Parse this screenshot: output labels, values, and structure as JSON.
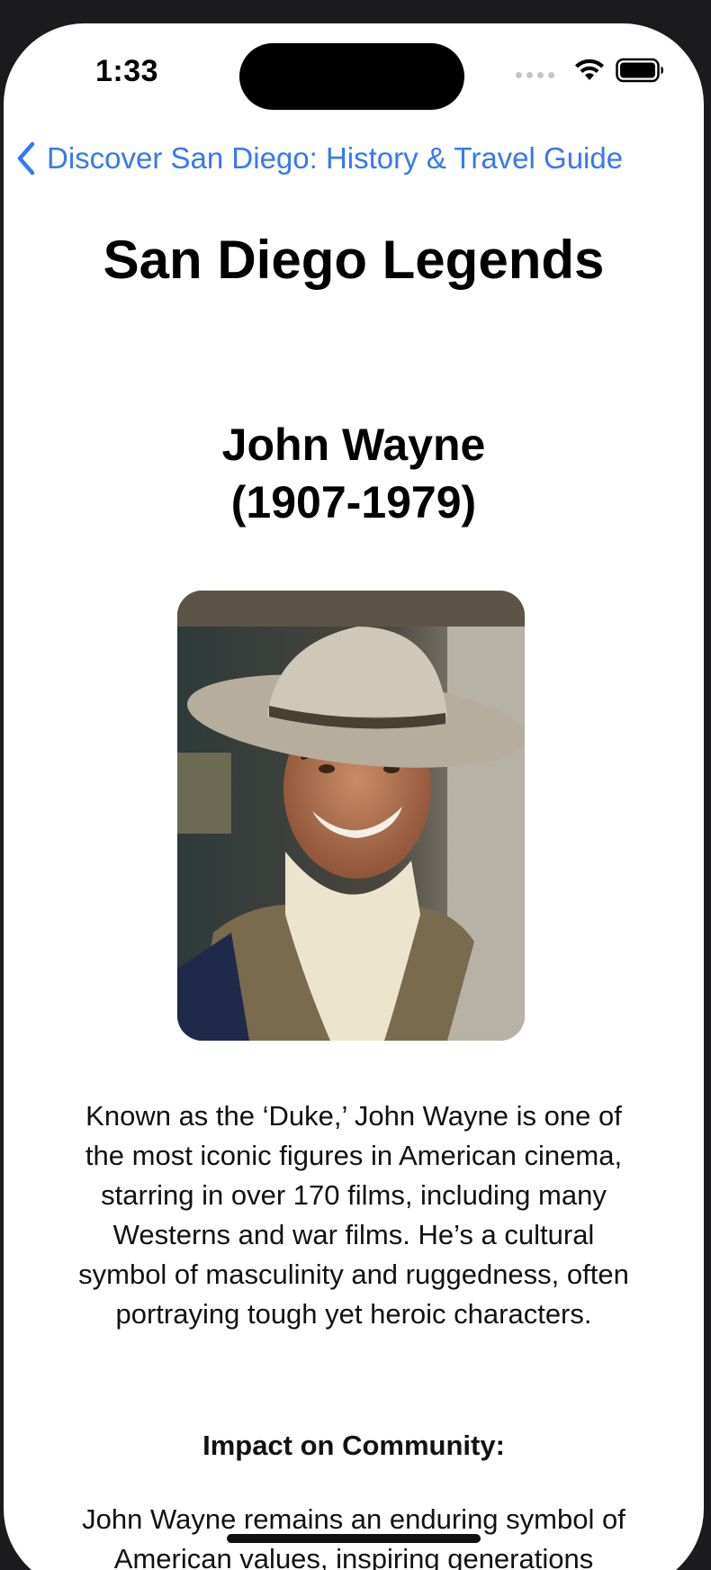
{
  "status_bar": {
    "time": "1:33"
  },
  "nav": {
    "back_label": "Discover San Diego: History & Travel Guide"
  },
  "page": {
    "title": "San Diego Legends"
  },
  "legend": {
    "name": "John Wayne\n(1907-1979)",
    "bio": "Known as the ‘Duke,’ John Wayne is one of the most iconic figures in American cinema, starring in over 170 films, including many Westerns and war films. He’s a cultural symbol of masculinity and ruggedness, often portraying tough yet heroic characters.",
    "impact_heading": "Impact on Community:",
    "impact_text": "John Wayne remains an enduring symbol of American values, inspiring generations"
  },
  "colors": {
    "accent": "#3478f6",
    "background": "#ffffff",
    "text": "#111111"
  }
}
